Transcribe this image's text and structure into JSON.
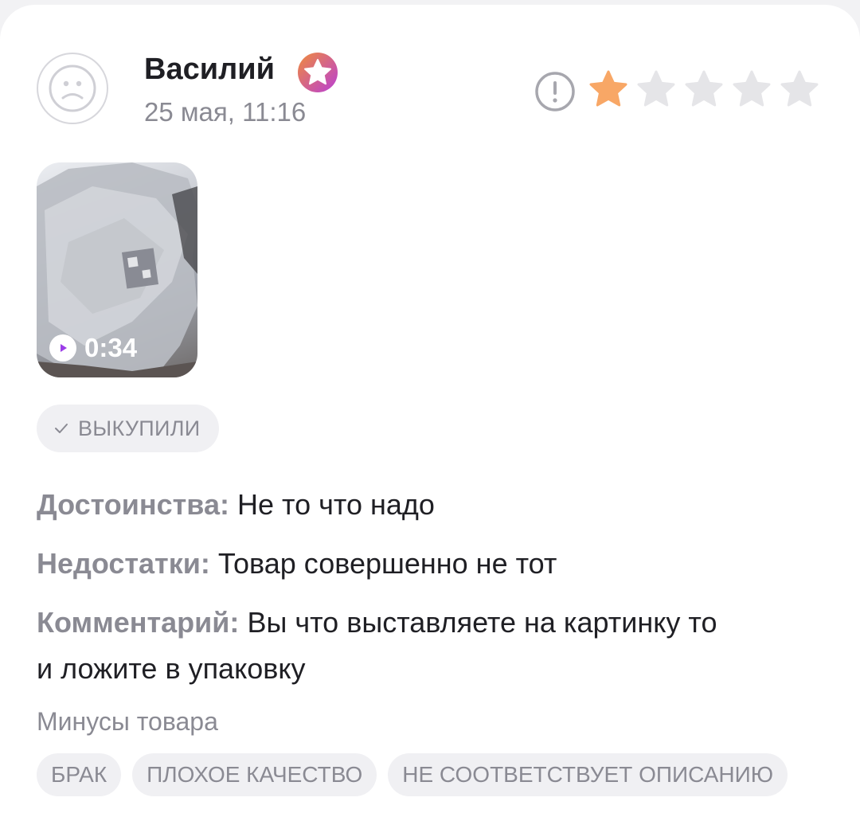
{
  "review": {
    "author": "Василий",
    "date": "25 мая, 11:16",
    "rating": 1,
    "max_rating": 5,
    "video_duration": "0:34",
    "bought_label": "ВЫКУПИЛИ",
    "pros_label": "Достоинства:",
    "pros_text": "Не то что надо",
    "cons_label": "Недостатки:",
    "cons_text": "Товар совершенно не тот",
    "comment_label": "Комментарий:",
    "comment_text": "Вы что выставляете на картинку то",
    "comment_text_line2": "и ложите в упаковку",
    "cons_tags_title": "Минусы товара",
    "cons_tags": [
      "БРАК",
      "ПЛОХОЕ КАЧЕСТВО",
      "НЕ СООТВЕТСТВУЕТ ОПИСАНИЮ"
    ]
  },
  "icons": {
    "avatar": "user-avatar-icon",
    "badge": "star-badge-icon",
    "report": "exclamation-circle-icon",
    "play": "play-icon",
    "check": "check-icon"
  },
  "colors": {
    "star_filled": "#f8a766",
    "star_empty": "#e5e5e8",
    "badge_gradient_start": "#f08b3b",
    "badge_gradient_end": "#b93fd6",
    "play_triangle": "#9b3de8",
    "muted_text": "#8a8a93"
  }
}
